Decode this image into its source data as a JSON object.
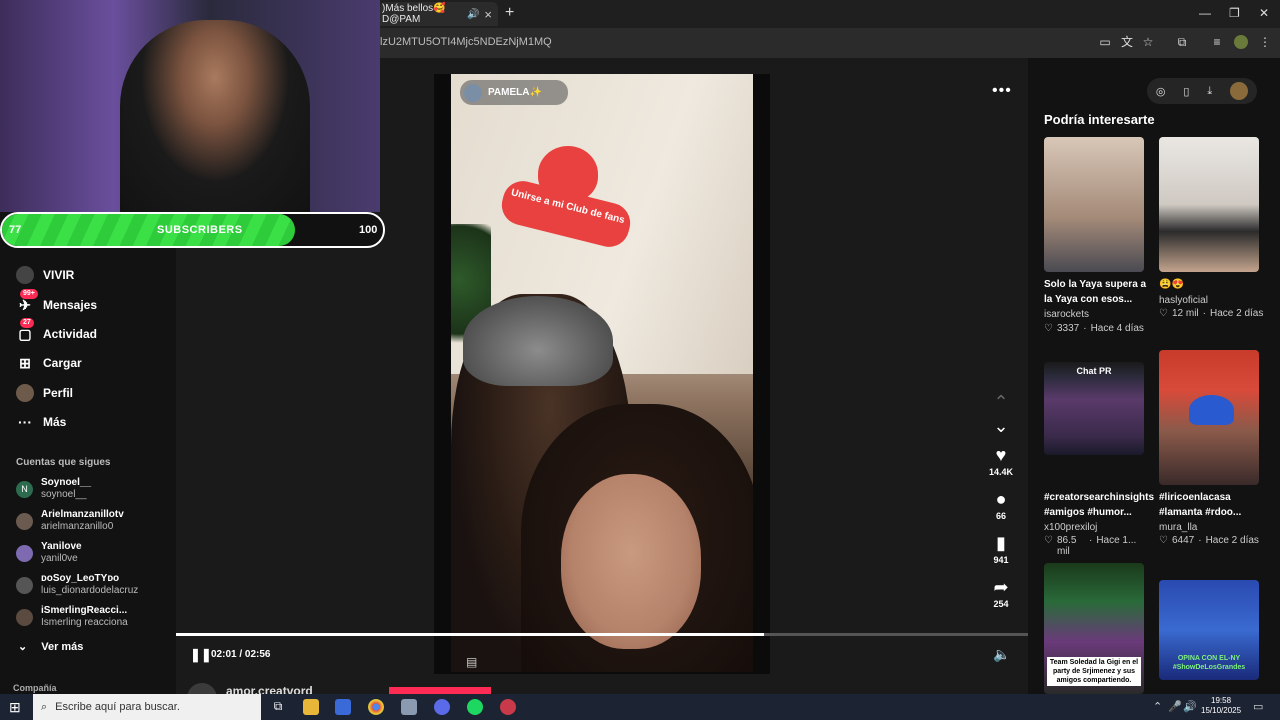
{
  "browser": {
    "tab_title": ")Más bellos🥰D@PAM",
    "url": "lzU2MTU5OTI4Mjc5NDEzNjM1MQ"
  },
  "stream": {
    "subs_current": "77",
    "subs_label": "SUBSCRIBERS",
    "subs_goal": "100",
    "subs_fill_fraction": 0.77
  },
  "nav": {
    "items": [
      {
        "label": "VIVIR",
        "badge": ""
      },
      {
        "label": "Mensajes",
        "badge": "99+"
      },
      {
        "label": "Actividad",
        "badge": "27"
      },
      {
        "label": "Cargar",
        "badge": ""
      },
      {
        "label": "Perfil",
        "badge": ""
      },
      {
        "label": "Más",
        "badge": ""
      }
    ],
    "following_title": "Cuentas que sigues",
    "following": [
      {
        "name": "Soynoel__",
        "handle": "soynoel__",
        "initial": "N"
      },
      {
        "name": "Arielmanzanillotv",
        "handle": "arielmanzanillo0",
        "initial": ""
      },
      {
        "name": "Yanilove",
        "handle": "yanil0ve",
        "initial": ""
      },
      {
        "name": "ᴅᴏSoy_LeoTYᴅᴏ",
        "handle": "luis_dionardodelacruz",
        "initial": ""
      },
      {
        "name": "iSmerlingReacci...",
        "handle": "Ismerling reacciona",
        "initial": ""
      }
    ],
    "see_more": "Ver más",
    "company": "Compañía"
  },
  "video": {
    "creator": "PAMELA✨",
    "overlay_text": "Unirse a mi Club de fans",
    "likes": "14.4K",
    "comments": "66",
    "saves": "941",
    "shares": "254",
    "time": "02:01 / 02:56",
    "progress_fraction": 0.69,
    "next_creator": "amor.creatvord"
  },
  "recommendations": {
    "title": "Podría interesarte",
    "items": [
      {
        "title": "Solo la Yaya supera a la Yaya con esos...",
        "author": "isarockets",
        "likes": "3337",
        "age": "Hace 4 días",
        "thumb_overlay": ""
      },
      {
        "title": "😩😍",
        "author": "haslyoficial",
        "likes": "12 mil",
        "age": "Hace 2 días",
        "thumb_overlay": ""
      },
      {
        "title": "#creatorsearchinsights #amigos #humor...",
        "author": "x100prexiloj",
        "likes": "86.5 mil",
        "age": "Hace 1...",
        "thumb_overlay": "Chat PR"
      },
      {
        "title": "#liricoenlacasa #lamanta #rdoo...",
        "author": "mura_lla",
        "likes": "6447",
        "age": "Hace 2 días",
        "thumb_overlay": ""
      },
      {
        "title": "",
        "author": "",
        "likes": "",
        "age": "",
        "thumb_overlay": "Team Soledad la Gigi en el party de Srjimenez y sus amigos compartiendo."
      },
      {
        "title": "",
        "author": "",
        "likes": "",
        "age": "",
        "thumb_overlay": "OPINA CON EL-NY #ShowDeLosGrandes"
      }
    ]
  },
  "taskbar": {
    "search_placeholder": "Escribe aquí para buscar.",
    "time": "19:58",
    "date": "15/10/2025"
  }
}
